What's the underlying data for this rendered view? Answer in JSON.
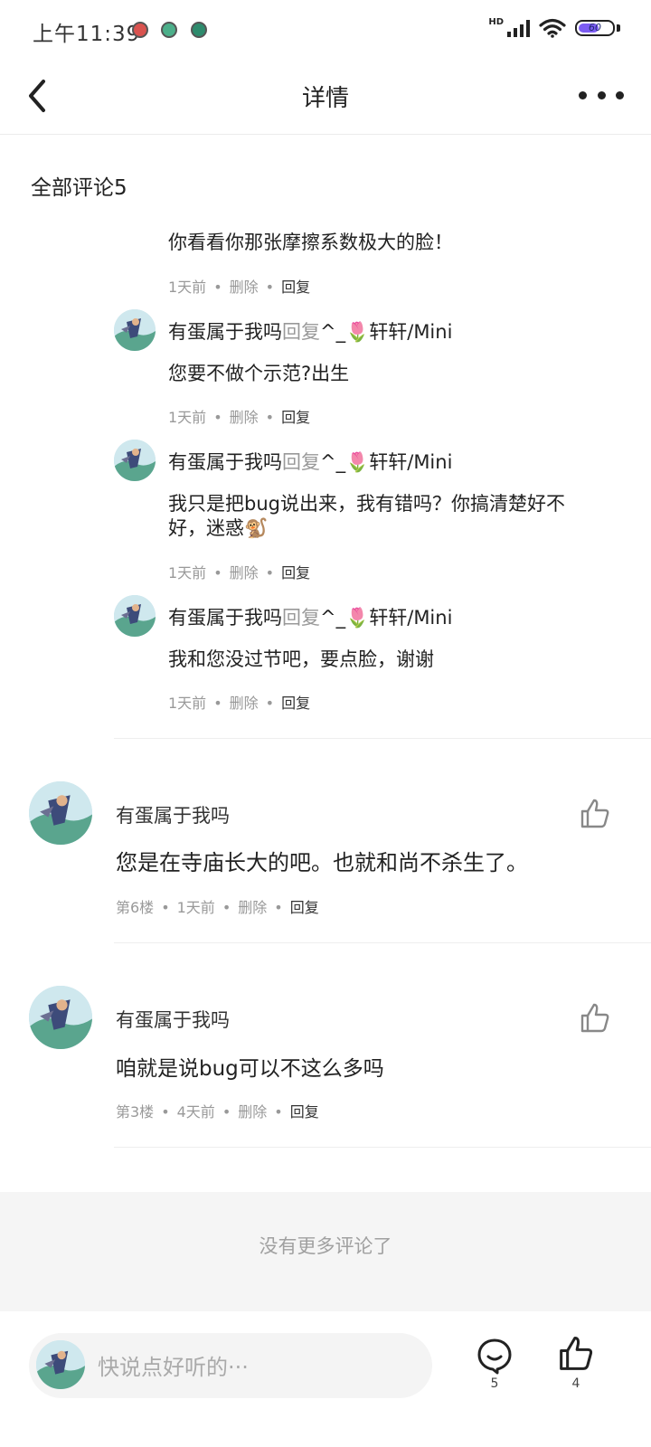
{
  "status_bar": {
    "time": "上午11:39",
    "network": "HD",
    "battery": "60",
    "battery_level_pct": 60,
    "accent": "#7c5cf2"
  },
  "nav": {
    "title": "详情",
    "back_icon": "chevron-left-icon",
    "more_icon": "more-horizontal-icon"
  },
  "comments_section": {
    "title": "全部评论5"
  },
  "replies": [
    {
      "text": "你看看你那张摩擦系数极大的脸！",
      "time": "1天前",
      "delete": "删除",
      "reply": "回复"
    },
    {
      "user": "有蛋属于我吗",
      "reply_word": "回复",
      "target": "^_🌷轩轩/Mini",
      "text": "您要不做个示范?出生",
      "time": "1天前",
      "delete": "删除",
      "reply": "回复"
    },
    {
      "user": "有蛋属于我吗",
      "reply_word": "回复",
      "target": "^_🌷轩轩/Mini",
      "text_line1": "我只是把bug说出来，我有错吗？你搞清楚好不",
      "text_line2": "好，迷惑🐒",
      "time": "1天前",
      "delete": "删除",
      "reply": "回复"
    },
    {
      "user": "有蛋属于我吗",
      "reply_word": "回复",
      "target": "^_🌷轩轩/Mini",
      "text": "我和您没过节吧，要点脸，谢谢",
      "time": "1天前",
      "delete": "删除",
      "reply": "回复"
    }
  ],
  "comments": [
    {
      "user": "有蛋属于我吗",
      "text": "您是在寺庙长大的吧。也就和尚不杀生了。",
      "floor": "第6楼",
      "time": "1天前",
      "delete": "删除",
      "reply": "回复",
      "like_icon": "thumbs-up-icon"
    },
    {
      "user": "有蛋属于我吗",
      "text": "咱就是说bug可以不这么多吗",
      "floor": "第3楼",
      "time": "4天前",
      "delete": "删除",
      "reply": "回复",
      "like_icon": "thumbs-up-icon"
    }
  ],
  "no_more": "没有更多评论了",
  "bottom_bar": {
    "placeholder": "快说点好听的···",
    "comment_count": "5",
    "like_count": "4",
    "comment_icon": "comment-bubble-icon",
    "like_icon": "thumbs-up-icon"
  }
}
